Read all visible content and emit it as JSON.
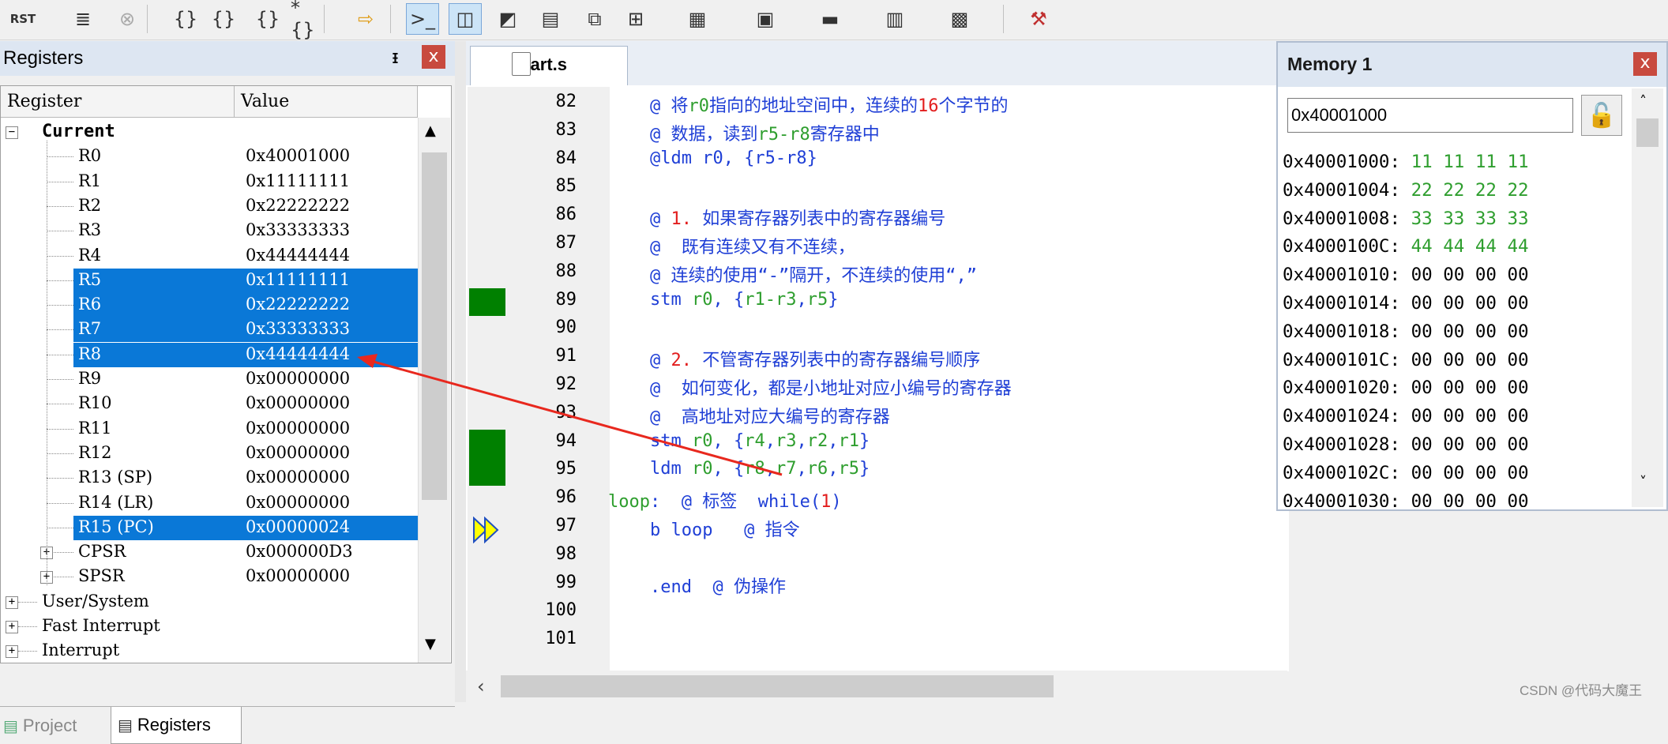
{
  "toolbar": {
    "buttons": [
      {
        "name": "reset-cpu-icon",
        "label": "RST"
      },
      {
        "name": "run-icon",
        "label": "≣"
      },
      {
        "name": "stop-icon",
        "label": "⊗"
      },
      {
        "name": "step-into-icon",
        "label": "{}"
      },
      {
        "name": "step-over-icon",
        "label": "{}"
      },
      {
        "name": "step-out-icon",
        "label": "{}"
      },
      {
        "name": "run-to-cursor-icon",
        "label": "*{}"
      },
      {
        "name": "show-next-statement-icon",
        "label": "⇨"
      },
      {
        "name": "command-window-icon",
        "label": ">_"
      },
      {
        "name": "disassembly-window-icon",
        "label": "◫"
      },
      {
        "name": "symbols-window-icon",
        "label": "◩"
      },
      {
        "name": "registers-window-icon",
        "label": "▤"
      },
      {
        "name": "call-stack-icon",
        "label": "⧉"
      },
      {
        "name": "watch-window-icon",
        "label": "⊞"
      },
      {
        "name": "memory-window-icon",
        "label": "▦"
      },
      {
        "name": "serial-window-icon",
        "label": "▣"
      },
      {
        "name": "analysis-window-icon",
        "label": "▬"
      },
      {
        "name": "trace-window-icon",
        "label": "▥"
      },
      {
        "name": "system-viewer-icon",
        "label": "▩"
      },
      {
        "name": "toolbox-icon",
        "label": "⚒"
      }
    ]
  },
  "registers": {
    "title": "Registers",
    "pin": "ᵻ",
    "close": "x",
    "col_register": "Register",
    "col_value": "Value",
    "current_label": "Current",
    "rows": [
      {
        "name": "R0",
        "value": "0x40001000"
      },
      {
        "name": "R1",
        "value": "0x11111111"
      },
      {
        "name": "R2",
        "value": "0x22222222"
      },
      {
        "name": "R3",
        "value": "0x33333333"
      },
      {
        "name": "R4",
        "value": "0x44444444"
      },
      {
        "name": "R5",
        "value": "0x11111111"
      },
      {
        "name": "R6",
        "value": "0x22222222"
      },
      {
        "name": "R7",
        "value": "0x33333333"
      },
      {
        "name": "R8",
        "value": "0x44444444"
      },
      {
        "name": "R9",
        "value": "0x00000000"
      },
      {
        "name": "R10",
        "value": "0x00000000"
      },
      {
        "name": "R11",
        "value": "0x00000000"
      },
      {
        "name": "R12",
        "value": "0x00000000"
      },
      {
        "name": "R13 (SP)",
        "value": "0x00000000"
      },
      {
        "name": "R14 (LR)",
        "value": "0x00000000"
      },
      {
        "name": "R15 (PC)",
        "value": "0x00000024"
      },
      {
        "name": "CPSR",
        "value": "0x000000D3"
      },
      {
        "name": "SPSR",
        "value": "0x00000000"
      }
    ],
    "groups": [
      "User/System",
      "Fast Interrupt",
      "Interrupt"
    ]
  },
  "bottom_tabs": {
    "project": "Project",
    "registers": "Registers"
  },
  "editor": {
    "tab": "start.s",
    "lines": [
      {
        "n": "82",
        "segs": [
          [
            "    @ 将",
            "blue"
          ],
          [
            "r0",
            "green"
          ],
          [
            "指向的地址空间中，连续的",
            "blue"
          ],
          [
            "16",
            "red"
          ],
          [
            "个字节的",
            "blue"
          ]
        ]
      },
      {
        "n": "83",
        "segs": [
          [
            "    @ 数据，读到",
            "blue"
          ],
          [
            "r5-r8",
            "green"
          ],
          [
            "寄存器中",
            "blue"
          ]
        ]
      },
      {
        "n": "84",
        "segs": [
          [
            "    @ldm r0, {r5-r8}",
            "blue"
          ]
        ]
      },
      {
        "n": "85",
        "segs": []
      },
      {
        "n": "86",
        "segs": [
          [
            "    @ ",
            "blue"
          ],
          [
            "1.",
            "red"
          ],
          [
            " 如果寄存器列表中的寄存器编号",
            "blue"
          ]
        ]
      },
      {
        "n": "87",
        "segs": [
          [
            "    @  既有连续又有不连续，",
            "blue"
          ]
        ]
      },
      {
        "n": "88",
        "segs": [
          [
            "    @ 连续的使用“-”隔开，不连续的使用“,”",
            "blue"
          ]
        ]
      },
      {
        "n": "89",
        "segs": [
          [
            "    stm ",
            "blue"
          ],
          [
            "r0",
            "green"
          ],
          [
            ", {",
            "blue"
          ],
          [
            "r1-r3",
            "green"
          ],
          [
            ",",
            "blue"
          ],
          [
            "r5",
            "green"
          ],
          [
            "}",
            "blue"
          ]
        ]
      },
      {
        "n": "90",
        "segs": []
      },
      {
        "n": "91",
        "segs": [
          [
            "    @ ",
            "blue"
          ],
          [
            "2.",
            "red"
          ],
          [
            " 不管寄存器列表中的寄存器编号顺序",
            "blue"
          ]
        ]
      },
      {
        "n": "92",
        "segs": [
          [
            "    @  如何变化，都是小地址对应小编号的寄存器",
            "blue"
          ]
        ]
      },
      {
        "n": "93",
        "segs": [
          [
            "    @  高地址对应大编号的寄存器",
            "blue"
          ]
        ]
      },
      {
        "n": "94",
        "segs": [
          [
            "    stm ",
            "blue"
          ],
          [
            "r0",
            "green"
          ],
          [
            ", {",
            "blue"
          ],
          [
            "r4",
            "green"
          ],
          [
            ",",
            "blue"
          ],
          [
            "r3",
            "green"
          ],
          [
            ",",
            "blue"
          ],
          [
            "r2",
            "green"
          ],
          [
            ",",
            "blue"
          ],
          [
            "r1",
            "green"
          ],
          [
            "}",
            "blue"
          ]
        ]
      },
      {
        "n": "95",
        "segs": [
          [
            "    ldm ",
            "blue"
          ],
          [
            "r0",
            "green"
          ],
          [
            ", {",
            "blue"
          ],
          [
            "r8",
            "green"
          ],
          [
            ",",
            "blue"
          ],
          [
            "r7",
            "green"
          ],
          [
            ",",
            "blue"
          ],
          [
            "r6",
            "green"
          ],
          [
            ",",
            "blue"
          ],
          [
            "r5",
            "green"
          ],
          [
            "}",
            "blue"
          ]
        ]
      },
      {
        "n": "96",
        "segs": [
          [
            "loop",
            "green"
          ],
          [
            ":  @ 标签  while(",
            "blue"
          ],
          [
            "1",
            "red"
          ],
          [
            ")",
            "blue"
          ]
        ]
      },
      {
        "n": "97",
        "segs": [
          [
            "    b loop   @ 指令",
            "blue"
          ]
        ]
      },
      {
        "n": "98",
        "segs": []
      },
      {
        "n": "99",
        "segs": [
          [
            "    .end  @ 伪操作",
            "blue"
          ]
        ]
      },
      {
        "n": "100",
        "segs": []
      },
      {
        "n": "101",
        "segs": []
      }
    ]
  },
  "memory": {
    "title": "Memory 1",
    "close": "x",
    "address": "0x40001000",
    "rows": [
      {
        "addr": "0x40001000:",
        "bytes": "11 11 11 11",
        "changed": true
      },
      {
        "addr": "0x40001004:",
        "bytes": "22 22 22 22",
        "changed": true
      },
      {
        "addr": "0x40001008:",
        "bytes": "33 33 33 33",
        "changed": true
      },
      {
        "addr": "0x4000100C:",
        "bytes": "44 44 44 44",
        "changed": true
      },
      {
        "addr": "0x40001010:",
        "bytes": "00 00 00 00",
        "changed": false
      },
      {
        "addr": "0x40001014:",
        "bytes": "00 00 00 00",
        "changed": false
      },
      {
        "addr": "0x40001018:",
        "bytes": "00 00 00 00",
        "changed": false
      },
      {
        "addr": "0x4000101C:",
        "bytes": "00 00 00 00",
        "changed": false
      },
      {
        "addr": "0x40001020:",
        "bytes": "00 00 00 00",
        "changed": false
      },
      {
        "addr": "0x40001024:",
        "bytes": "00 00 00 00",
        "changed": false
      },
      {
        "addr": "0x40001028:",
        "bytes": "00 00 00 00",
        "changed": false
      },
      {
        "addr": "0x4000102C:",
        "bytes": "00 00 00 00",
        "changed": false
      },
      {
        "addr": "0x40001030:",
        "bytes": "00 00 00 00",
        "changed": false
      }
    ]
  },
  "watermark": "CSDN @代码大魔王",
  "colors": {
    "selection": "#0a78d7",
    "code_blue": "#1f3fd6",
    "code_green": "#2e9e2e",
    "code_red": "#e21d1d",
    "breakpoint_green": "#008000",
    "arrow_red": "#e8281e"
  }
}
